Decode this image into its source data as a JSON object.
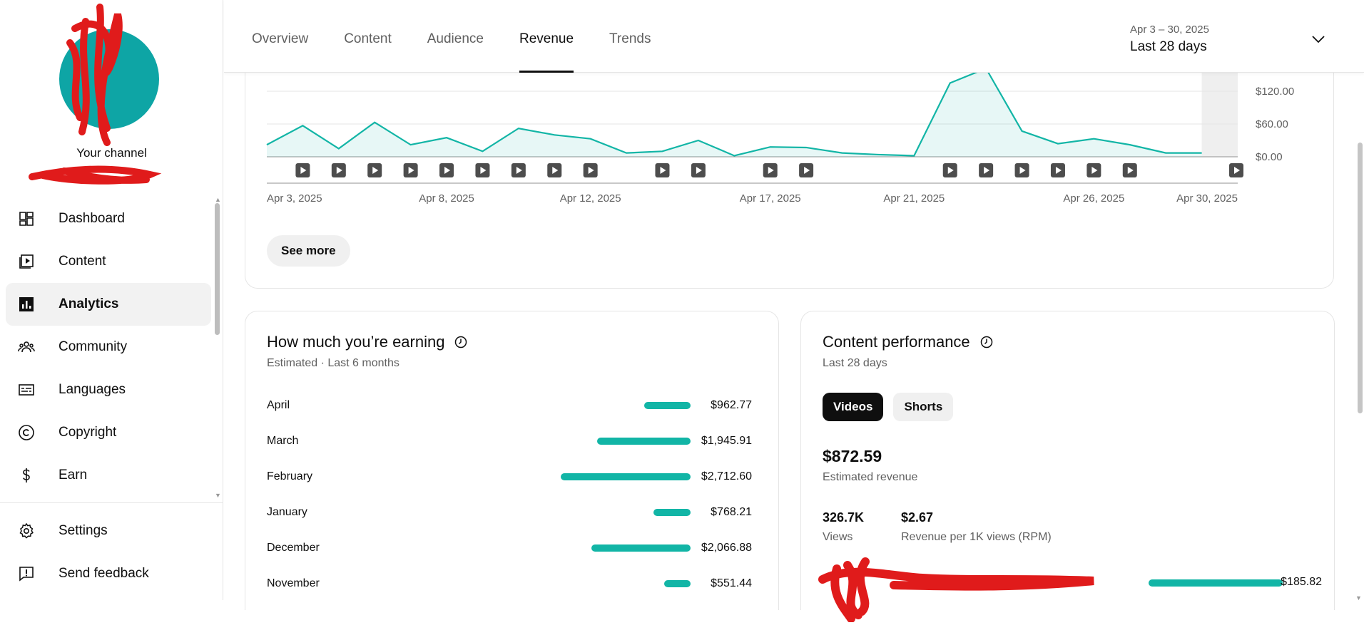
{
  "sidebar": {
    "channel_name": "Your channel",
    "items": [
      {
        "label": "Dashboard",
        "icon": "dashboard-icon",
        "active": false
      },
      {
        "label": "Content",
        "icon": "content-icon",
        "active": false
      },
      {
        "label": "Analytics",
        "icon": "analytics-icon",
        "active": true
      },
      {
        "label": "Community",
        "icon": "community-icon",
        "active": false
      },
      {
        "label": "Languages",
        "icon": "languages-icon",
        "active": false
      },
      {
        "label": "Copyright",
        "icon": "copyright-icon",
        "active": false
      },
      {
        "label": "Earn",
        "icon": "earn-icon",
        "active": false
      }
    ],
    "footer_items": [
      {
        "label": "Settings",
        "icon": "gear-icon"
      },
      {
        "label": "Send feedback",
        "icon": "feedback-icon"
      }
    ]
  },
  "header": {
    "tabs": [
      {
        "label": "Overview",
        "active": false
      },
      {
        "label": "Content",
        "active": false
      },
      {
        "label": "Audience",
        "active": false
      },
      {
        "label": "Revenue",
        "active": true
      },
      {
        "label": "Trends",
        "active": false
      }
    ],
    "date_range": "Apr 3 – 30, 2025",
    "date_label": "Last 28 days"
  },
  "chart_data": {
    "type": "area",
    "x": [
      "Apr 3",
      "Apr 4",
      "Apr 5",
      "Apr 6",
      "Apr 7",
      "Apr 8",
      "Apr 9",
      "Apr 10",
      "Apr 11",
      "Apr 12",
      "Apr 13",
      "Apr 14",
      "Apr 15",
      "Apr 16",
      "Apr 17",
      "Apr 18",
      "Apr 19",
      "Apr 20",
      "Apr 21",
      "Apr 22",
      "Apr 23",
      "Apr 24",
      "Apr 25",
      "Apr 26",
      "Apr 27",
      "Apr 28",
      "Apr 29",
      "Apr 30"
    ],
    "y": [
      22,
      57,
      15,
      63,
      22,
      35,
      10,
      52,
      40,
      33,
      7,
      10,
      30,
      2,
      18,
      17,
      7,
      4,
      2,
      135,
      165,
      47,
      24,
      33,
      22,
      7,
      7,
      null
    ],
    "x_tick_labels": [
      "Apr 3, 2025",
      "Apr 8, 2025",
      "Apr 12, 2025",
      "Apr 17, 2025",
      "Apr 21, 2025",
      "Apr 26, 2025",
      "Apr 30, 2025"
    ],
    "y_tick_labels": [
      "$120.00",
      "$60.00",
      "$0.00"
    ],
    "ylim": [
      0,
      160
    ],
    "color": "#12b5a6",
    "upload_markers": [
      "Apr 4",
      "Apr 5",
      "Apr 6",
      "Apr 7",
      "Apr 8",
      "Apr 9",
      "Apr 10",
      "Apr 11",
      "Apr 12",
      "Apr 14",
      "Apr 15",
      "Apr 17",
      "Apr 18",
      "Apr 22",
      "Apr 23",
      "Apr 24",
      "Apr 25",
      "Apr 26",
      "Apr 27",
      "Apr 30"
    ],
    "grid": true
  },
  "see_more_label": "See more",
  "earnings": {
    "title": "How much you’re earning",
    "subtitle": "Estimated · Last 6 months",
    "rows": [
      {
        "month": "April",
        "value": "$962.77",
        "amount": 962.77
      },
      {
        "month": "March",
        "value": "$1,945.91",
        "amount": 1945.91
      },
      {
        "month": "February",
        "value": "$2,712.60",
        "amount": 2712.6
      },
      {
        "month": "January",
        "value": "$768.21",
        "amount": 768.21
      },
      {
        "month": "December",
        "value": "$2,066.88",
        "amount": 2066.88
      },
      {
        "month": "November",
        "value": "$551.44",
        "amount": 551.44
      }
    ]
  },
  "performance": {
    "title": "Content performance",
    "subtitle": "Last 28 days",
    "chips": [
      {
        "label": "Videos",
        "active": true
      },
      {
        "label": "Shorts",
        "active": false
      }
    ],
    "revenue": "$872.59",
    "revenue_label": "Estimated revenue",
    "views": "326.7K",
    "views_label": "Views",
    "rpm": "$2.67",
    "rpm_label": "Revenue per 1K views (RPM)",
    "top_video_value": "$185.82"
  }
}
